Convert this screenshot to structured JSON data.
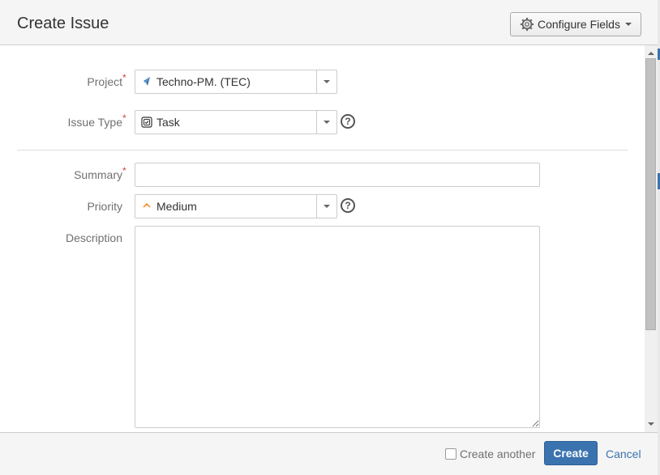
{
  "dialog": {
    "title": "Create Issue",
    "configure_fields_label": "Configure Fields"
  },
  "form": {
    "project": {
      "label": "Project",
      "value": "Techno-PM. (TEC)",
      "icon": "project-rocket-icon"
    },
    "issue_type": {
      "label": "Issue Type",
      "value": "Task",
      "icon": "task-checkbox-icon"
    },
    "summary": {
      "label": "Summary",
      "value": ""
    },
    "priority": {
      "label": "Priority",
      "value": "Medium",
      "icon": "priority-medium-arrow-icon"
    },
    "description": {
      "label": "Description",
      "value": ""
    },
    "required_marker": "*",
    "help_glyph": "?"
  },
  "footer": {
    "create_another_label": "Create another",
    "create_another_checked": false,
    "create_label": "Create",
    "cancel_label": "Cancel"
  },
  "colors": {
    "accent": "#3b73af",
    "required": "#d04437",
    "priority_medium": "#f79232"
  }
}
